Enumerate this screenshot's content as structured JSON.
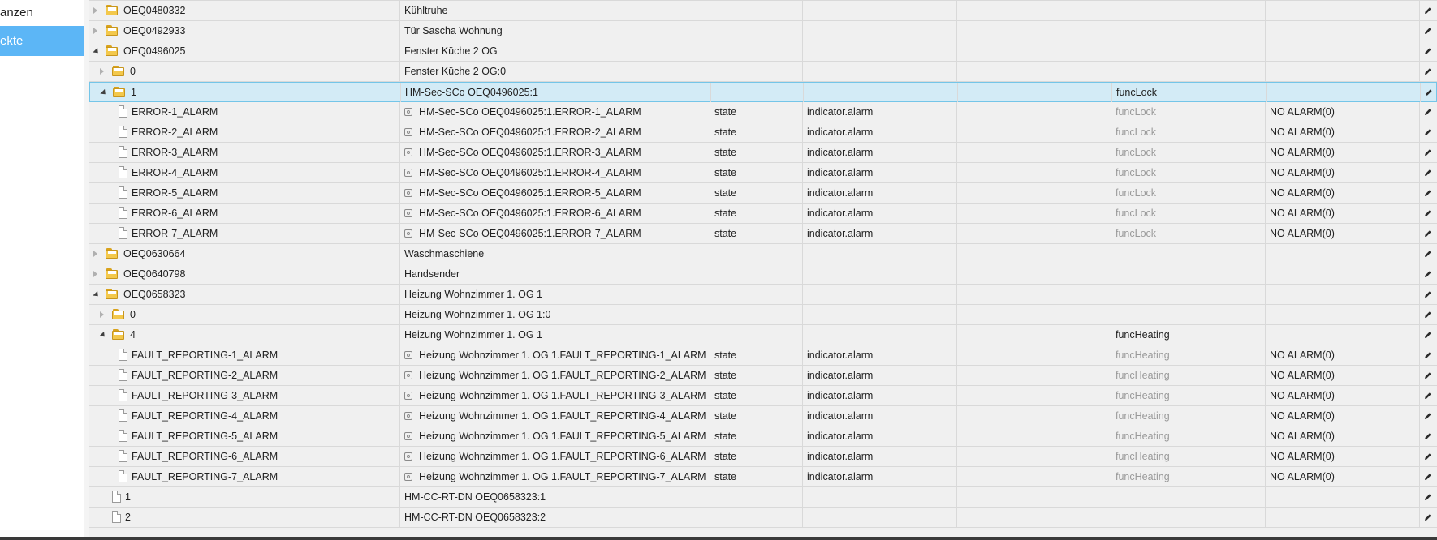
{
  "sidebar": {
    "items": [
      {
        "label": "anzen",
        "active": false
      },
      {
        "label": "ekte",
        "active": true
      }
    ]
  },
  "colors": {
    "accent": "#5cb6f6",
    "selected_row": "#d3ebf6",
    "folder": "#f3c84b",
    "muted_text": "#9a9a9a"
  },
  "rows": [
    {
      "indent": 0,
      "kind": "folder",
      "expander": "closed",
      "name": "OEQ0480332",
      "title": "Kühltruhe",
      "title_icon": false,
      "type": "",
      "role": "",
      "room": "",
      "func": "",
      "func_muted": false,
      "value": "",
      "selected": false
    },
    {
      "indent": 0,
      "kind": "folder",
      "expander": "closed",
      "name": "OEQ0492933",
      "title": "Tür Sascha Wohnung",
      "title_icon": false,
      "type": "",
      "role": "",
      "room": "",
      "func": "",
      "func_muted": false,
      "value": "",
      "selected": false
    },
    {
      "indent": 0,
      "kind": "folder",
      "expander": "open",
      "name": "OEQ0496025",
      "title": "Fenster Küche 2 OG",
      "title_icon": false,
      "type": "",
      "role": "",
      "room": "",
      "func": "",
      "func_muted": false,
      "value": "",
      "selected": false
    },
    {
      "indent": 1,
      "kind": "folder",
      "expander": "closed",
      "name": "0",
      "title": "Fenster Küche 2 OG:0",
      "title_icon": false,
      "type": "",
      "role": "",
      "room": "",
      "func": "",
      "func_muted": false,
      "value": "",
      "selected": false
    },
    {
      "indent": 1,
      "kind": "folder",
      "expander": "open",
      "name": "1",
      "title": "HM-Sec-SCo OEQ0496025:1",
      "title_icon": false,
      "type": "",
      "role": "",
      "room": "",
      "func": "funcLock",
      "func_muted": false,
      "value": "",
      "selected": true
    },
    {
      "indent": 2,
      "kind": "file",
      "expander": "none",
      "name": "ERROR-1_ALARM",
      "title": "HM-Sec-SCo OEQ0496025:1.ERROR-1_ALARM",
      "title_icon": true,
      "type": "state",
      "role": "indicator.alarm",
      "room": "",
      "func": "funcLock",
      "func_muted": true,
      "value": "NO ALARM(0)",
      "selected": false
    },
    {
      "indent": 2,
      "kind": "file",
      "expander": "none",
      "name": "ERROR-2_ALARM",
      "title": "HM-Sec-SCo OEQ0496025:1.ERROR-2_ALARM",
      "title_icon": true,
      "type": "state",
      "role": "indicator.alarm",
      "room": "",
      "func": "funcLock",
      "func_muted": true,
      "value": "NO ALARM(0)",
      "selected": false
    },
    {
      "indent": 2,
      "kind": "file",
      "expander": "none",
      "name": "ERROR-3_ALARM",
      "title": "HM-Sec-SCo OEQ0496025:1.ERROR-3_ALARM",
      "title_icon": true,
      "type": "state",
      "role": "indicator.alarm",
      "room": "",
      "func": "funcLock",
      "func_muted": true,
      "value": "NO ALARM(0)",
      "selected": false
    },
    {
      "indent": 2,
      "kind": "file",
      "expander": "none",
      "name": "ERROR-4_ALARM",
      "title": "HM-Sec-SCo OEQ0496025:1.ERROR-4_ALARM",
      "title_icon": true,
      "type": "state",
      "role": "indicator.alarm",
      "room": "",
      "func": "funcLock",
      "func_muted": true,
      "value": "NO ALARM(0)",
      "selected": false
    },
    {
      "indent": 2,
      "kind": "file",
      "expander": "none",
      "name": "ERROR-5_ALARM",
      "title": "HM-Sec-SCo OEQ0496025:1.ERROR-5_ALARM",
      "title_icon": true,
      "type": "state",
      "role": "indicator.alarm",
      "room": "",
      "func": "funcLock",
      "func_muted": true,
      "value": "NO ALARM(0)",
      "selected": false
    },
    {
      "indent": 2,
      "kind": "file",
      "expander": "none",
      "name": "ERROR-6_ALARM",
      "title": "HM-Sec-SCo OEQ0496025:1.ERROR-6_ALARM",
      "title_icon": true,
      "type": "state",
      "role": "indicator.alarm",
      "room": "",
      "func": "funcLock",
      "func_muted": true,
      "value": "NO ALARM(0)",
      "selected": false
    },
    {
      "indent": 2,
      "kind": "file",
      "expander": "none",
      "name": "ERROR-7_ALARM",
      "title": "HM-Sec-SCo OEQ0496025:1.ERROR-7_ALARM",
      "title_icon": true,
      "type": "state",
      "role": "indicator.alarm",
      "room": "",
      "func": "funcLock",
      "func_muted": true,
      "value": "NO ALARM(0)",
      "selected": false
    },
    {
      "indent": 0,
      "kind": "folder",
      "expander": "closed",
      "name": "OEQ0630664",
      "title": "Waschmaschiene",
      "title_icon": false,
      "type": "",
      "role": "",
      "room": "",
      "func": "",
      "func_muted": false,
      "value": "",
      "selected": false
    },
    {
      "indent": 0,
      "kind": "folder",
      "expander": "closed",
      "name": "OEQ0640798",
      "title": "Handsender",
      "title_icon": false,
      "type": "",
      "role": "",
      "room": "",
      "func": "",
      "func_muted": false,
      "value": "",
      "selected": false
    },
    {
      "indent": 0,
      "kind": "folder",
      "expander": "open",
      "name": "OEQ0658323",
      "title": "Heizung Wohnzimmer 1. OG 1",
      "title_icon": false,
      "type": "",
      "role": "",
      "room": "",
      "func": "",
      "func_muted": false,
      "value": "",
      "selected": false
    },
    {
      "indent": 1,
      "kind": "folder",
      "expander": "closed",
      "name": "0",
      "title": "Heizung Wohnzimmer 1. OG 1:0",
      "title_icon": false,
      "type": "",
      "role": "",
      "room": "",
      "func": "",
      "func_muted": false,
      "value": "",
      "selected": false
    },
    {
      "indent": 1,
      "kind": "folder",
      "expander": "open",
      "name": "4",
      "title": "Heizung Wohnzimmer 1. OG 1",
      "title_icon": false,
      "type": "",
      "role": "",
      "room": "",
      "func": "funcHeating",
      "func_muted": false,
      "value": "",
      "selected": false
    },
    {
      "indent": 2,
      "kind": "file",
      "expander": "none",
      "name": "FAULT_REPORTING-1_ALARM",
      "title": "Heizung Wohnzimmer 1. OG 1.FAULT_REPORTING-1_ALARM",
      "title_icon": true,
      "type": "state",
      "role": "indicator.alarm",
      "room": "",
      "func": "funcHeating",
      "func_muted": true,
      "value": "NO ALARM(0)",
      "selected": false
    },
    {
      "indent": 2,
      "kind": "file",
      "expander": "none",
      "name": "FAULT_REPORTING-2_ALARM",
      "title": "Heizung Wohnzimmer 1. OG 1.FAULT_REPORTING-2_ALARM",
      "title_icon": true,
      "type": "state",
      "role": "indicator.alarm",
      "room": "",
      "func": "funcHeating",
      "func_muted": true,
      "value": "NO ALARM(0)",
      "selected": false
    },
    {
      "indent": 2,
      "kind": "file",
      "expander": "none",
      "name": "FAULT_REPORTING-3_ALARM",
      "title": "Heizung Wohnzimmer 1. OG 1.FAULT_REPORTING-3_ALARM",
      "title_icon": true,
      "type": "state",
      "role": "indicator.alarm",
      "room": "",
      "func": "funcHeating",
      "func_muted": true,
      "value": "NO ALARM(0)",
      "selected": false
    },
    {
      "indent": 2,
      "kind": "file",
      "expander": "none",
      "name": "FAULT_REPORTING-4_ALARM",
      "title": "Heizung Wohnzimmer 1. OG 1.FAULT_REPORTING-4_ALARM",
      "title_icon": true,
      "type": "state",
      "role": "indicator.alarm",
      "room": "",
      "func": "funcHeating",
      "func_muted": true,
      "value": "NO ALARM(0)",
      "selected": false
    },
    {
      "indent": 2,
      "kind": "file",
      "expander": "none",
      "name": "FAULT_REPORTING-5_ALARM",
      "title": "Heizung Wohnzimmer 1. OG 1.FAULT_REPORTING-5_ALARM",
      "title_icon": true,
      "type": "state",
      "role": "indicator.alarm",
      "room": "",
      "func": "funcHeating",
      "func_muted": true,
      "value": "NO ALARM(0)",
      "selected": false
    },
    {
      "indent": 2,
      "kind": "file",
      "expander": "none",
      "name": "FAULT_REPORTING-6_ALARM",
      "title": "Heizung Wohnzimmer 1. OG 1.FAULT_REPORTING-6_ALARM",
      "title_icon": true,
      "type": "state",
      "role": "indicator.alarm",
      "room": "",
      "func": "funcHeating",
      "func_muted": true,
      "value": "NO ALARM(0)",
      "selected": false
    },
    {
      "indent": 2,
      "kind": "file",
      "expander": "none",
      "name": "FAULT_REPORTING-7_ALARM",
      "title": "Heizung Wohnzimmer 1. OG 1.FAULT_REPORTING-7_ALARM",
      "title_icon": true,
      "type": "state",
      "role": "indicator.alarm",
      "room": "",
      "func": "funcHeating",
      "func_muted": true,
      "value": "NO ALARM(0)",
      "selected": false
    },
    {
      "indent": 1,
      "kind": "file",
      "expander": "none",
      "name": "1",
      "title": "HM-CC-RT-DN OEQ0658323:1",
      "title_icon": false,
      "type": "",
      "role": "",
      "room": "",
      "func": "",
      "func_muted": false,
      "value": "",
      "selected": false
    },
    {
      "indent": 1,
      "kind": "file",
      "expander": "none",
      "name": "2",
      "title": "HM-CC-RT-DN OEQ0658323:2",
      "title_icon": false,
      "type": "",
      "role": "",
      "room": "",
      "func": "",
      "func_muted": false,
      "value": "",
      "selected": false
    }
  ]
}
